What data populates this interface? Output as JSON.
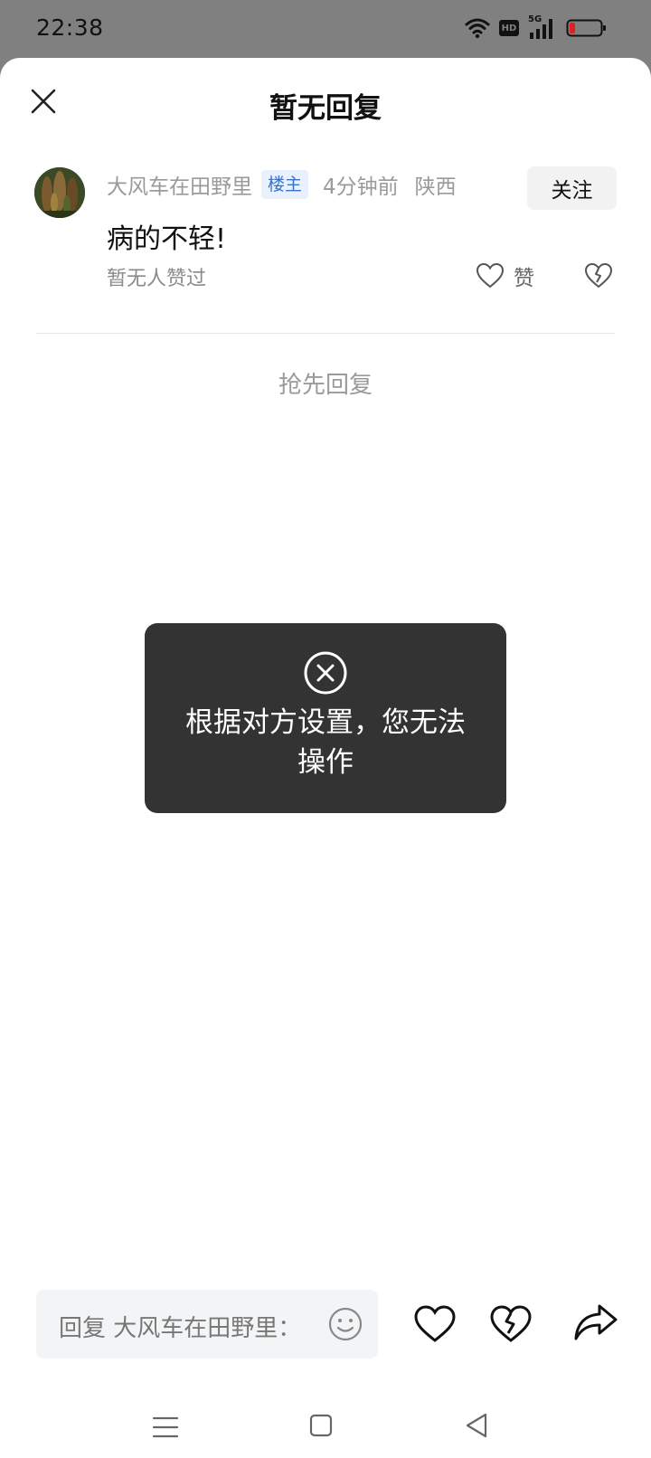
{
  "status_bar": {
    "time": "22:38",
    "icons": [
      "wifi-icon",
      "hd-icon",
      "signal-5g-icon",
      "battery-low-icon"
    ],
    "hd_label": "HD",
    "network_label": "5G"
  },
  "sheet": {
    "title": "暂无回复"
  },
  "comment": {
    "author": "大风车在田野里",
    "op_badge": "楼主",
    "time": "4分钟前",
    "location": "陕西",
    "follow_label": "关注",
    "text": "病的不轻!",
    "likes_text": "暂无人赞过",
    "like_label": "赞"
  },
  "first_reply_label": "抢先回复",
  "toast": {
    "message": "根据对方设置，您无法操作",
    "icon": "close-circle-icon"
  },
  "reply_bar": {
    "placeholder": "回复 大风车在田野里："
  },
  "colors": {
    "status_bar_bg": "#808080",
    "toast_bg": "#333333",
    "op_badge_text": "#3a72c8",
    "op_badge_bg": "#e8f1fd",
    "muted_text": "#9a9a9a"
  }
}
